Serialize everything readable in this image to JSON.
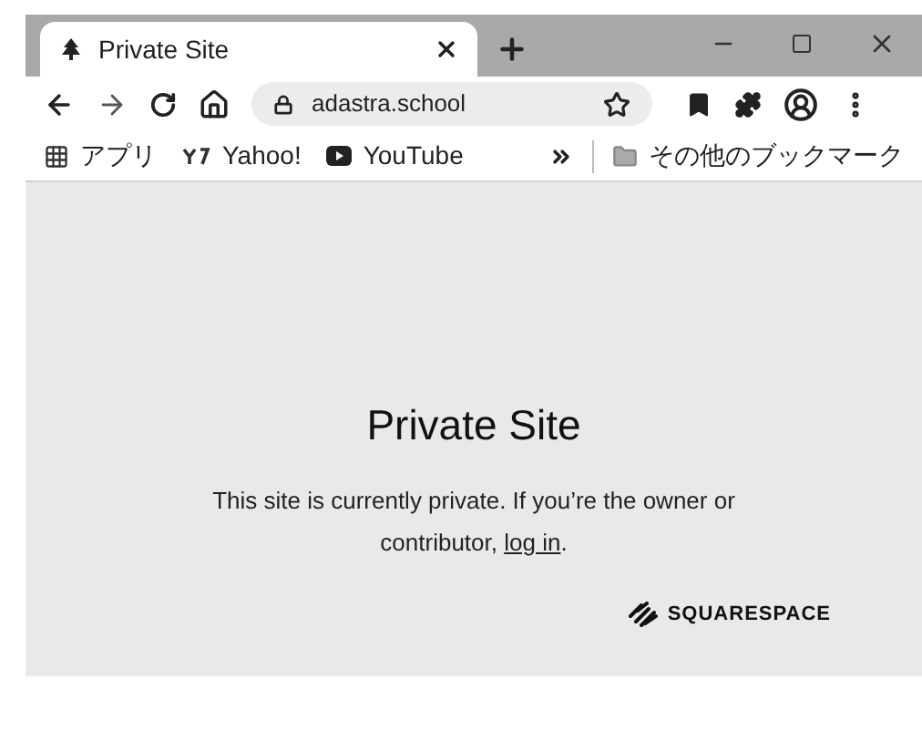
{
  "tabs": [
    {
      "title": "Private Site",
      "selected": true
    }
  ],
  "address_bar": {
    "url": "adastra.school"
  },
  "bookmarks": [
    {
      "label": "アプリ",
      "kind": "apps"
    },
    {
      "label": "Yahoo!",
      "kind": "yahoo"
    },
    {
      "label": "YouTube",
      "kind": "youtube"
    }
  ],
  "other_bookmarks": "その他のブックマーク",
  "page": {
    "title": "Private Site",
    "message": "This site is currently private. If you’re the owner or contributor, ",
    "link": "log in",
    "message_end": ".",
    "brand": "SQUARESPACE"
  }
}
